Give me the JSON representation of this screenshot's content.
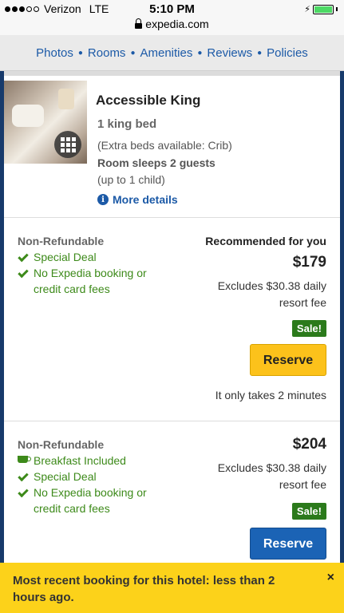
{
  "status": {
    "carrier": "Verizon",
    "network": "LTE",
    "time": "5:10 PM"
  },
  "url": "expedia.com",
  "nav": [
    "Photos",
    "Rooms",
    "Amenities",
    "Reviews",
    "Policies"
  ],
  "room": {
    "title": "Accessible King",
    "bed": "1 king bed",
    "extra_beds": "(Extra beds available: Crib)",
    "sleeps": "Room sleeps 2 guests",
    "children": "(up to 1 child)",
    "more_details": "More details"
  },
  "rates": [
    {
      "type": "Non-Refundable",
      "features": [
        "Special Deal",
        "No Expedia booking or",
        "credit card fees"
      ],
      "recommended": "Recommended for you",
      "price": "$179",
      "excludes_1": "Excludes $30.38 daily",
      "excludes_2": "resort fee",
      "badge": "Sale!",
      "button": "Reserve",
      "button_color": "#fcc21b",
      "note": "It only takes 2 minutes"
    },
    {
      "type": "Non-Refundable",
      "features": [
        "Breakfast Included",
        "Special Deal",
        "No Expedia booking or",
        "credit card fees"
      ],
      "price": "$204",
      "excludes_1": "Excludes $30.38 daily",
      "excludes_2": "resort fee",
      "badge": "Sale!",
      "button": "Reserve",
      "button_color": "#1b63b5"
    }
  ],
  "banner": {
    "text": "Most recent booking for this hotel: less than 2 hours ago.",
    "close": "×"
  },
  "colors": {
    "nav_link": "#1c5aa7",
    "feature_green": "#3d8a1a",
    "banner_bg": "#fcd21a",
    "sale_badge": "#2b7a1b"
  }
}
